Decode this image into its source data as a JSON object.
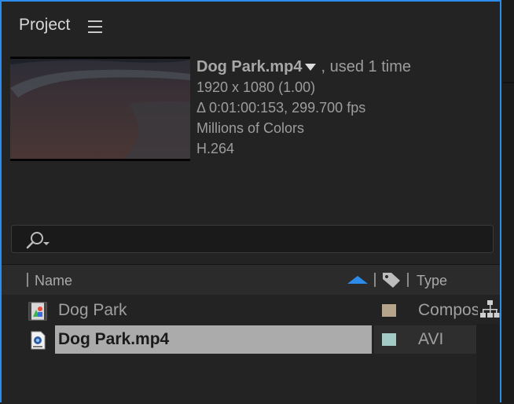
{
  "panel": {
    "title": "Project",
    "menu_icon": "hamburger-menu-icon",
    "accent_color": "#2d8ceb"
  },
  "footage_info": {
    "filename": "Dog Park.mp4",
    "usage": ", used 1 time",
    "resolution": "1920 x 1080 (1.00)",
    "duration": "Δ 0:01:00:153, 299.700 fps",
    "colors": "Millions of Colors",
    "codec": "H.264"
  },
  "search": {
    "icon": "search-icon",
    "value": ""
  },
  "columns": {
    "name": "Name",
    "type": "Type",
    "sort_icon": "sort-ascending-icon",
    "label_icon": "tag-icon"
  },
  "items": [
    {
      "name": "Dog Park",
      "type": "Composition",
      "icon": "composition-icon",
      "label_color": "#b4a58b",
      "selected": false
    },
    {
      "name": "Dog Park.mp4",
      "type": "AVI",
      "icon": "video-file-icon",
      "label_color": "#a3cbc6",
      "selected": true
    }
  ],
  "flowchart_icon": "flowchart-icon"
}
